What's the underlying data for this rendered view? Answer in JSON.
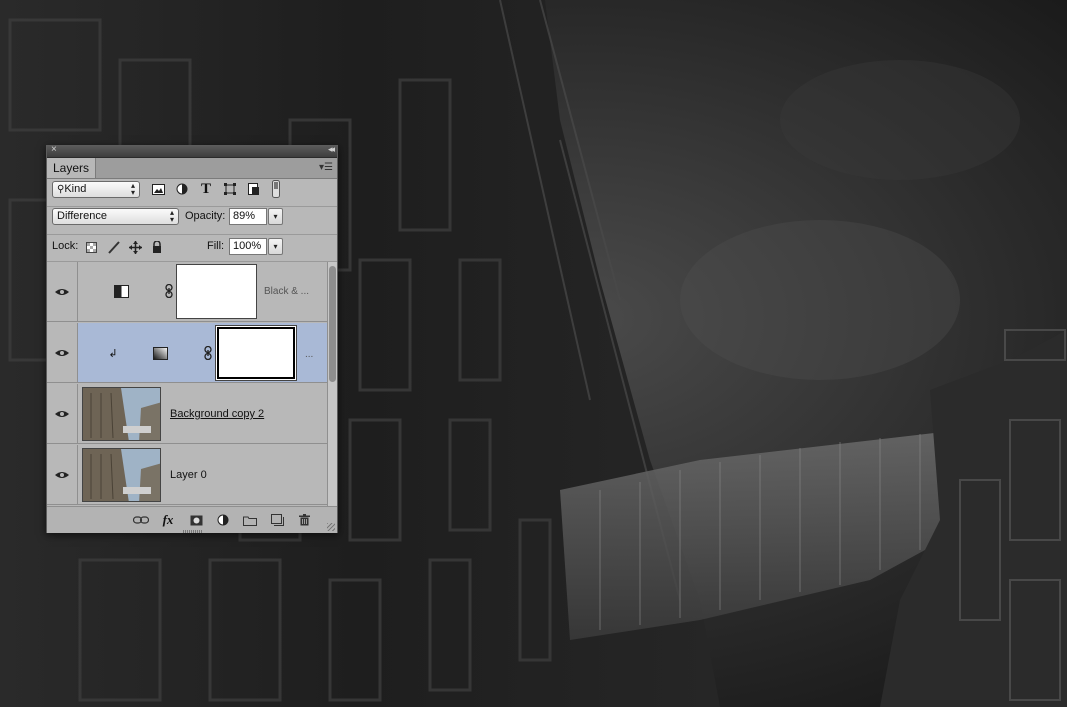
{
  "panel": {
    "tab_label": "Layers",
    "close_glyph": "×",
    "collapse_glyph": "◂◂",
    "menu_glyph": "▾☰"
  },
  "filter": {
    "kind_label": "Kind",
    "icons": [
      "image-filter-icon",
      "adjustment-filter-icon",
      "type-filter-icon",
      "shape-filter-icon",
      "smart-object-filter-icon",
      "filter-toggle-icon"
    ]
  },
  "blend": {
    "mode": "Difference",
    "opacity_label": "Opacity:",
    "opacity_value": "89%"
  },
  "lock": {
    "label": "Lock:",
    "fill_label": "Fill:",
    "fill_value": "100%"
  },
  "layers": [
    {
      "name": "Black & ...",
      "type": "adjustment",
      "adj_icon": "black-white-adjustment-icon",
      "visible": true,
      "selected": false
    },
    {
      "name": "...",
      "type": "adjustment",
      "adj_icon": "gradient-map-adjustment-icon",
      "visible": true,
      "selected": true,
      "clipped": true
    },
    {
      "name": "Background copy 2",
      "type": "pixel",
      "visible": true,
      "selected": false
    },
    {
      "name": "Layer 0",
      "type": "pixel",
      "visible": true,
      "selected": false
    }
  ],
  "footer": {
    "icons": [
      "link-layers-icon",
      "fx-icon",
      "add-mask-icon",
      "new-adjustment-icon",
      "new-group-icon",
      "new-layer-icon",
      "trash-icon"
    ],
    "fx_label": "fx"
  },
  "colors": {
    "selected_row": "#a9b9d6",
    "panel_bg": "#b8b8b8"
  }
}
